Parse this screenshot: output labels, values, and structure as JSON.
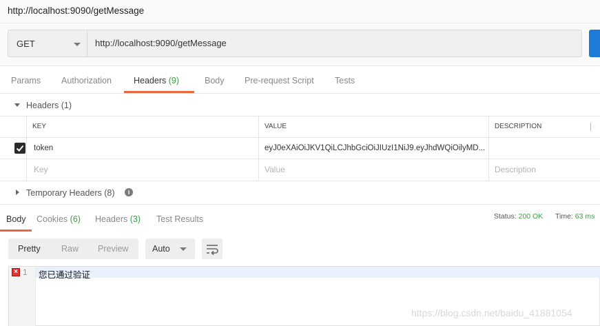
{
  "window": {
    "title": "http://localhost:9090/getMessage"
  },
  "request": {
    "method": "GET",
    "url": "http://localhost:9090/getMessage"
  },
  "request_tabs": [
    {
      "label": "Params",
      "count": ""
    },
    {
      "label": "Authorization",
      "count": ""
    },
    {
      "label": "Headers",
      "count": "(9)"
    },
    {
      "label": "Body",
      "count": ""
    },
    {
      "label": "Pre-request Script",
      "count": ""
    },
    {
      "label": "Tests",
      "count": ""
    }
  ],
  "active_request_tab": "Headers",
  "headers_section": {
    "label": "Headers",
    "count": "(1)",
    "columns": [
      "KEY",
      "VALUE",
      "DESCRIPTION"
    ],
    "rows": [
      {
        "checked": true,
        "key": "token",
        "value": "eyJ0eXAiOiJKV1QiLCJhbGciOiJIUzI1NiJ9.eyJhdWQiOilyMD...",
        "description": ""
      }
    ],
    "placeholders": {
      "key": "Key",
      "value": "Value",
      "description": "Description"
    }
  },
  "temporary_headers": {
    "label": "Temporary Headers",
    "count": "(8)"
  },
  "response_tabs": [
    {
      "label": "Body",
      "count": ""
    },
    {
      "label": "Cookies",
      "count": "(6)"
    },
    {
      "label": "Headers",
      "count": "(3)"
    },
    {
      "label": "Test Results",
      "count": ""
    }
  ],
  "active_response_tab": "Body",
  "status": {
    "status_label": "Status:",
    "status_value": "200 OK",
    "time_label": "Time:",
    "time_value": "63 ms"
  },
  "format_buttons": [
    "Pretty",
    "Raw",
    "Preview"
  ],
  "active_format": "Pretty",
  "content_type": "Auto",
  "editor": {
    "line_number": "1",
    "content": "您已通过验证"
  },
  "watermark": "https://blog.csdn.net/baidu_41881054",
  "colors": {
    "accent": "#e8683f",
    "count_green": "#3f9c49",
    "send_blue": "#1f7bd8"
  },
  "icons": [
    "chevron-down-icon",
    "checkmark-icon",
    "info-icon",
    "wrap-icon",
    "error-icon"
  ]
}
